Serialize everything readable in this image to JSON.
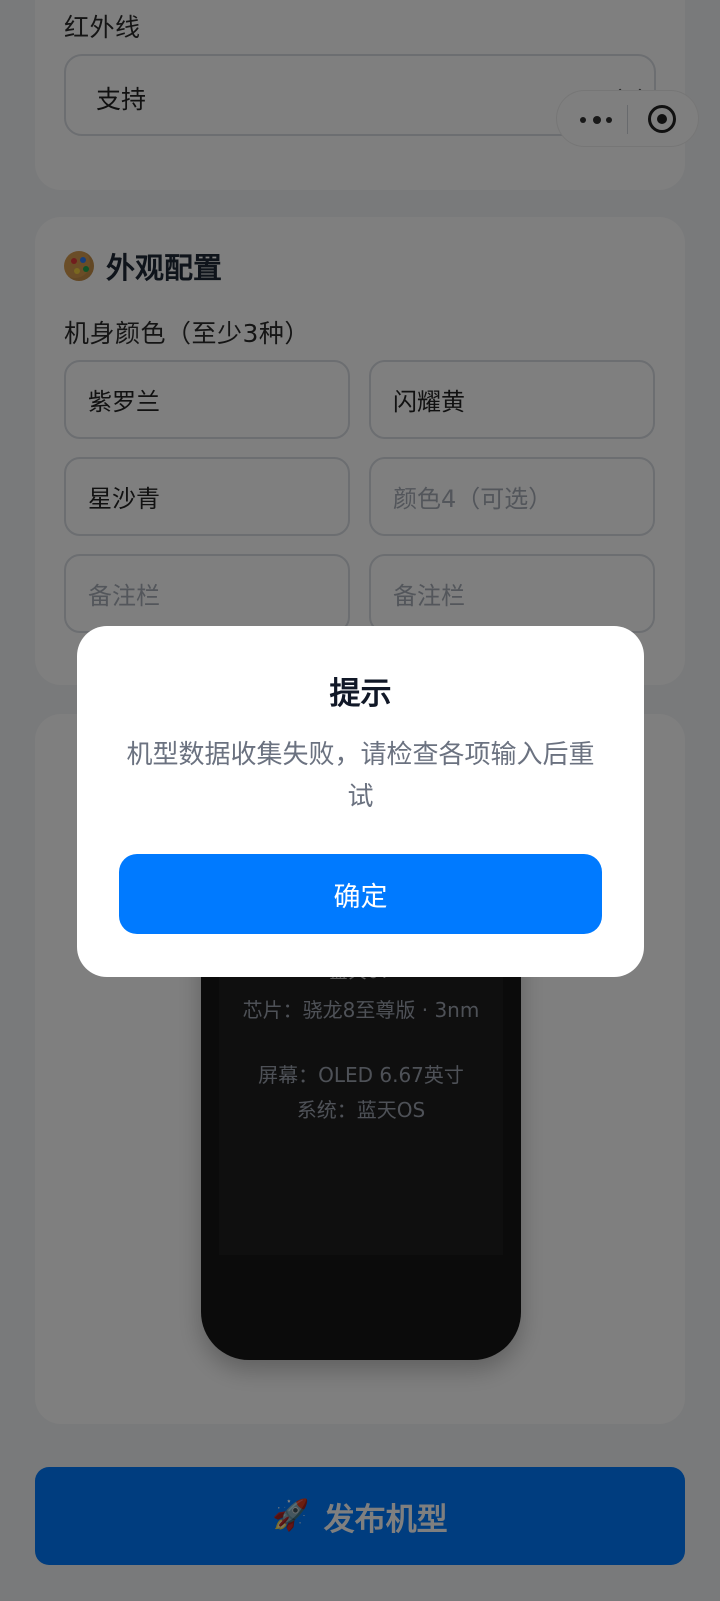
{
  "hardware": {
    "infrared_label": "红外线",
    "infrared_value": "支持"
  },
  "appearance": {
    "title": "外观配置",
    "colors_label": "机身颜色（至少3种）",
    "color_inputs": [
      {
        "value": "紫罗兰",
        "placeholder": ""
      },
      {
        "value": "闪耀黄",
        "placeholder": ""
      },
      {
        "value": "星沙青",
        "placeholder": ""
      },
      {
        "value": "",
        "placeholder": "颜色4（可选）"
      },
      {
        "value": "",
        "placeholder": "备注栏"
      },
      {
        "value": "",
        "placeholder": "备注栏"
      }
    ]
  },
  "preview": {
    "model_name": "蓝天07",
    "chip": "芯片：骁龙8至尊版 · 3nm",
    "screen": "屏幕：OLED 6.67英寸",
    "system": "系统：蓝天OS"
  },
  "publish_button": {
    "label": "发布机型"
  },
  "dialog": {
    "title": "提示",
    "message": "机型数据收集失败，请检查各项输入后重试",
    "confirm_label": "确定"
  },
  "icons": {
    "palette": "palette-icon",
    "rocket": "rocket-icon",
    "more": "more-icon",
    "close": "close-icon"
  },
  "colors": {
    "accent": "#007aff",
    "overlay": "rgba(0,0,0,0.5)"
  }
}
